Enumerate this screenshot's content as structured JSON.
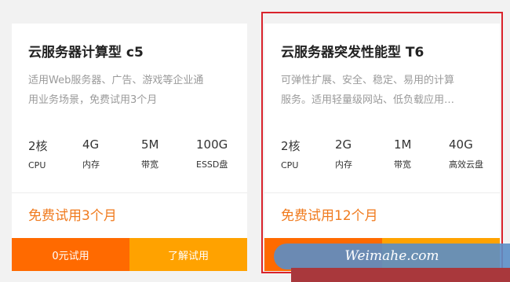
{
  "cards": [
    {
      "title": "云服务器计算型 c5",
      "desc_line1": "适用Web服务器、广告、游戏等企业通",
      "desc_line2": "用业务场景，免费试用3个月",
      "specs": [
        {
          "value": "2核",
          "unit": "CPU"
        },
        {
          "value": "4G",
          "unit": "内存"
        },
        {
          "value": "5M",
          "unit": "带宽"
        },
        {
          "value": "100G",
          "unit": "ESSD盘"
        }
      ],
      "promo": "免费试用3个月",
      "btn_left": "0元试用",
      "btn_right": "了解试用"
    },
    {
      "title": "云服务器突发性能型 T6",
      "desc_line1": "可弹性扩展、安全、稳定、易用的计算",
      "desc_line2": "服务。适用轻量级网站、低负载应用…",
      "specs": [
        {
          "value": "2核",
          "unit": "CPU"
        },
        {
          "value": "2G",
          "unit": "内存"
        },
        {
          "value": "1M",
          "unit": "带宽"
        },
        {
          "value": "40G",
          "unit": "高效云盘"
        }
      ],
      "promo": "免费试用12个月",
      "btn_left": "",
      "btn_right": ""
    }
  ],
  "watermark": "Weimahe.com",
  "colors": {
    "promo": "#f07a1d",
    "btn_primary": "#ff6a00",
    "btn_secondary": "#ffa200",
    "highlight": "#d9232c"
  }
}
